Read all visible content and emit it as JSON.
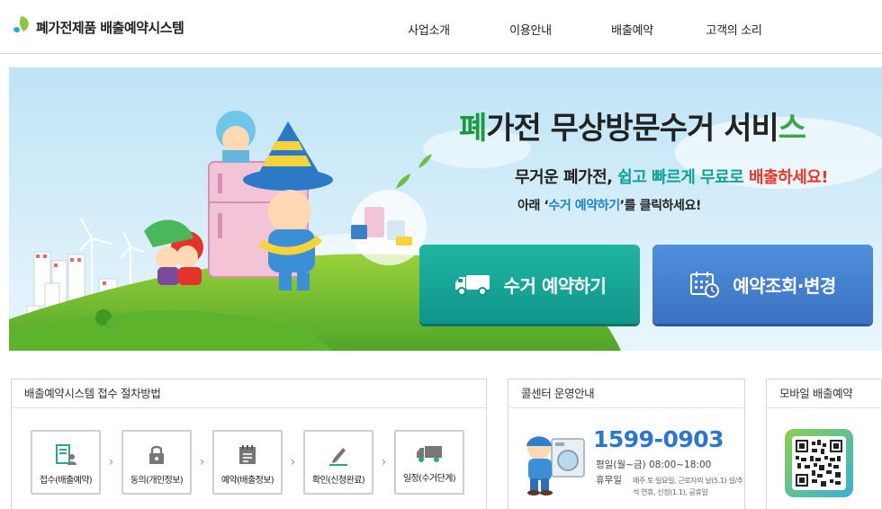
{
  "header": {
    "logo_text": "폐가전제품 배출예약시스템",
    "nav": [
      "사업소개",
      "이용안내",
      "배출예약",
      "고객의 소리"
    ]
  },
  "banner": {
    "headline": {
      "first": "폐",
      "middle": "가전 무상방문수거 서비",
      "last": "스"
    },
    "sub1": {
      "a": "무거운 폐가전, ",
      "b": "쉽고 빠르게 무료로",
      "c": " ",
      "d": "배출하세요!"
    },
    "sub2": {
      "a": "아래 ‘",
      "b": "수거 예약하기",
      "c": "’를 클릭하세요!"
    },
    "cta_pickup": "수거 예약하기",
    "cta_lookup": "예약조회·변경"
  },
  "steps_box": {
    "title": "배출예약시스템 접수 절차방법",
    "steps": [
      {
        "label": "접수(배출예약)",
        "icon": "document-person-icon"
      },
      {
        "label": "동의(개인정보)",
        "icon": "lock-icon"
      },
      {
        "label": "예약(배출정보)",
        "icon": "calendar-list-icon"
      },
      {
        "label": "확인(신청완료)",
        "icon": "pencil-icon"
      },
      {
        "label": "일정(수거단계)",
        "icon": "truck-icon"
      }
    ],
    "arrow": "›"
  },
  "call_box": {
    "title": "콜센터 운영안내",
    "phone": "1599-0903",
    "hours_label": "평일(월~금)",
    "hours_value": "08:00~18:00",
    "closed_label": "휴무일",
    "closed_note": "매주 토·일요일, 근로자의 날(5.1) 설/추석 연휴, 신정(1.1), 공휴일"
  },
  "mobile_box": {
    "title": "모바일 배출예약"
  },
  "colors": {
    "teal_button": "#12a098",
    "blue_button": "#3b72c2",
    "phone_blue": "#2b77d0",
    "accent_red": "#e8382b",
    "accent_green": "#1a9a3c"
  }
}
